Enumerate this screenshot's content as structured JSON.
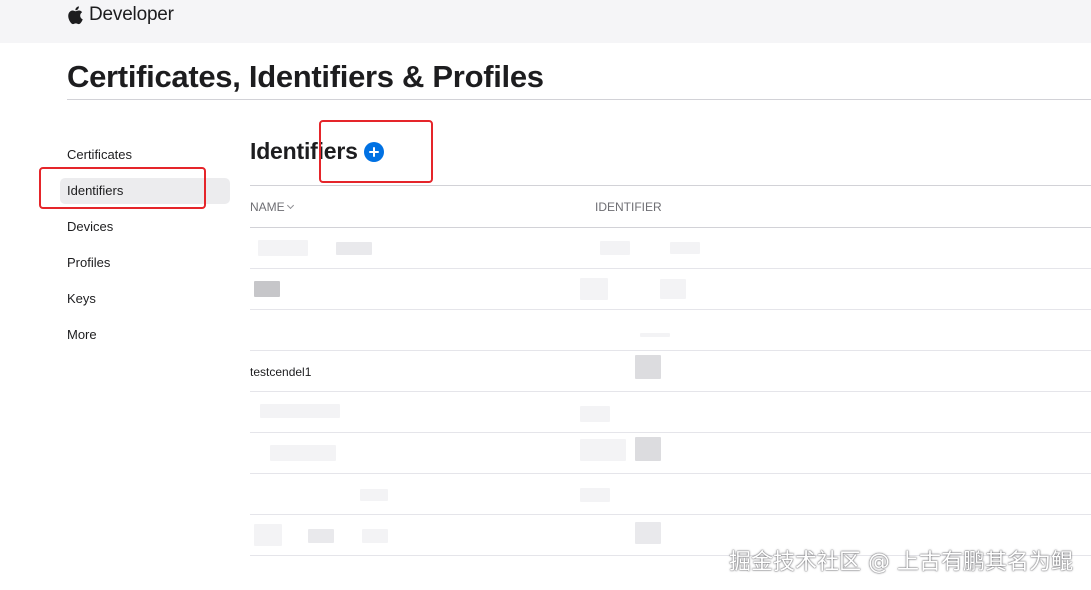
{
  "header": {
    "brand_label": "Developer",
    "brand_icon": "apple-icon"
  },
  "page_title": "Certificates, Identifiers & Profiles",
  "sidebar": {
    "items": [
      {
        "label": "Certificates",
        "active": false
      },
      {
        "label": "Identifiers",
        "active": true
      },
      {
        "label": "Devices",
        "active": false
      },
      {
        "label": "Profiles",
        "active": false
      },
      {
        "label": "Keys",
        "active": false
      },
      {
        "label": "More",
        "active": false
      }
    ]
  },
  "section": {
    "title": "Identifiers",
    "add_icon": "plus-circle-icon"
  },
  "table": {
    "columns": [
      "NAME",
      "IDENTIFIER"
    ],
    "rows": [
      {
        "name": "",
        "identifier": ""
      },
      {
        "name": "",
        "identifier": ""
      },
      {
        "name": "",
        "identifier": ""
      },
      {
        "name": "testcendel1",
        "identifier": ""
      },
      {
        "name": "",
        "identifier": ""
      },
      {
        "name": "",
        "identifier": ""
      },
      {
        "name": "",
        "identifier": ""
      },
      {
        "name": "",
        "identifier": ""
      }
    ]
  },
  "watermark": "掘金技术社区 @ 上古有鹏其名为鲲",
  "colors": {
    "accent": "#0071e3",
    "highlight": "#e5252a",
    "active_bg": "#ececee"
  }
}
